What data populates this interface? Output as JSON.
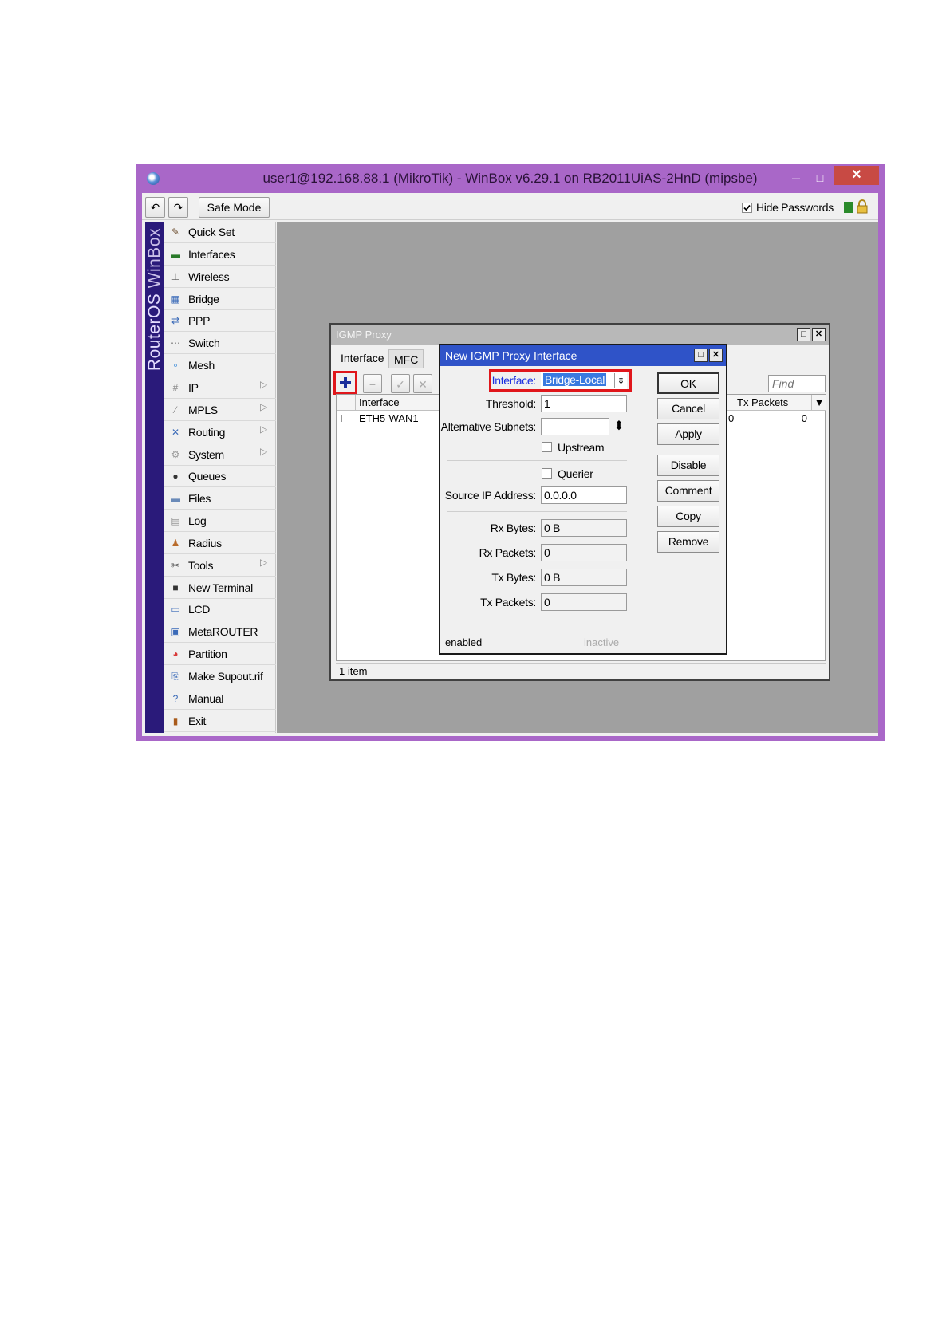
{
  "window": {
    "title": "user1@192.168.88.1 (MikroTik) - WinBox v6.29.1 on RB2011UiAS-2HnD (mipsbe)",
    "close_glyph": "✕",
    "minimize_glyph": "–",
    "maximize_glyph": "□"
  },
  "toolbar": {
    "undo_glyph": "↶",
    "redo_glyph": "↷",
    "safe_mode_label": "Safe Mode",
    "hide_passwords_label": "Hide Passwords"
  },
  "brand": {
    "os": "RouterOS",
    "app": " WinBox"
  },
  "sidebar": {
    "items": [
      {
        "label": "Quick Set",
        "icon": "quick-set-icon",
        "glyph": "✎"
      },
      {
        "label": "Interfaces",
        "icon": "interfaces-icon",
        "glyph": "▬"
      },
      {
        "label": "Wireless",
        "icon": "wireless-icon",
        "glyph": "⊥"
      },
      {
        "label": "Bridge",
        "icon": "bridge-icon",
        "glyph": "▦"
      },
      {
        "label": "PPP",
        "icon": "ppp-icon",
        "glyph": "⇄"
      },
      {
        "label": "Switch",
        "icon": "switch-icon",
        "glyph": "⋯"
      },
      {
        "label": "Mesh",
        "icon": "mesh-icon",
        "glyph": "∘"
      },
      {
        "label": "IP",
        "icon": "ip-icon",
        "glyph": "#",
        "arrow": "▷"
      },
      {
        "label": "MPLS",
        "icon": "mpls-icon",
        "glyph": "⁄",
        "arrow": "▷"
      },
      {
        "label": "Routing",
        "icon": "routing-icon",
        "glyph": "✕",
        "arrow": "▷"
      },
      {
        "label": "System",
        "icon": "system-icon",
        "glyph": "⚙",
        "arrow": "▷"
      },
      {
        "label": "Queues",
        "icon": "queues-icon",
        "glyph": "●"
      },
      {
        "label": "Files",
        "icon": "files-icon",
        "glyph": "▬"
      },
      {
        "label": "Log",
        "icon": "log-icon",
        "glyph": "▤"
      },
      {
        "label": "Radius",
        "icon": "radius-icon",
        "glyph": "♟"
      },
      {
        "label": "Tools",
        "icon": "tools-icon",
        "glyph": "✂",
        "arrow": "▷"
      },
      {
        "label": "New Terminal",
        "icon": "terminal-icon",
        "glyph": "■"
      },
      {
        "label": "LCD",
        "icon": "lcd-icon",
        "glyph": "▭"
      },
      {
        "label": "MetaROUTER",
        "icon": "metarouter-icon",
        "glyph": "▣"
      },
      {
        "label": "Partition",
        "icon": "partition-icon",
        "glyph": "◕"
      },
      {
        "label": "Make Supout.rif",
        "icon": "supout-icon",
        "glyph": "⎘"
      },
      {
        "label": "Manual",
        "icon": "manual-icon",
        "glyph": "?"
      },
      {
        "label": "Exit",
        "icon": "exit-icon",
        "glyph": "▮"
      }
    ]
  },
  "igmp_window": {
    "title": "IGMP Proxy",
    "tabs": [
      "Interface",
      "MFC"
    ],
    "add_glyph": "+",
    "remove_glyph": "−",
    "enable_glyph": "✓",
    "disable_glyph": "✕",
    "find_placeholder": "Find",
    "columns": [
      "Interface",
      "Tx Packets"
    ],
    "rows": [
      {
        "flag": "I",
        "interface": "ETH5-WAN1",
        "rx": "0",
        "tx": "0"
      }
    ],
    "status": "1 item",
    "column_menu_glyph": "▼"
  },
  "dialog": {
    "title": "New IGMP Proxy Interface",
    "interface_label": "Interface:",
    "interface_value": "Bridge-Local",
    "threshold_label": "Threshold:",
    "threshold_value": "1",
    "alt_subnets_label": "Alternative Subnets:",
    "upstream_label": "Upstream",
    "querier_label": "Querier",
    "source_ip_label": "Source IP Address:",
    "source_ip_value": "0.0.0.0",
    "rx_bytes_label": "Rx Bytes:",
    "rx_bytes_value": "0 B",
    "rx_packets_label": "Rx Packets:",
    "rx_packets_value": "0",
    "tx_bytes_label": "Tx Bytes:",
    "tx_bytes_value": "0 B",
    "tx_packets_label": "Tx Packets:",
    "tx_packets_value": "0",
    "buttons": [
      "OK",
      "Cancel",
      "Apply",
      "Disable",
      "Comment",
      "Copy",
      "Remove"
    ],
    "status_left": "enabled",
    "status_right": "inactive",
    "dropdown_glyph": "⇟",
    "updown_glyph": "⬍"
  },
  "colors": {
    "window_frame": "#a967c8",
    "dialog_title": "#2f53c8",
    "highlight_box": "#e0161b",
    "brand_band": "#2a1a7a"
  }
}
